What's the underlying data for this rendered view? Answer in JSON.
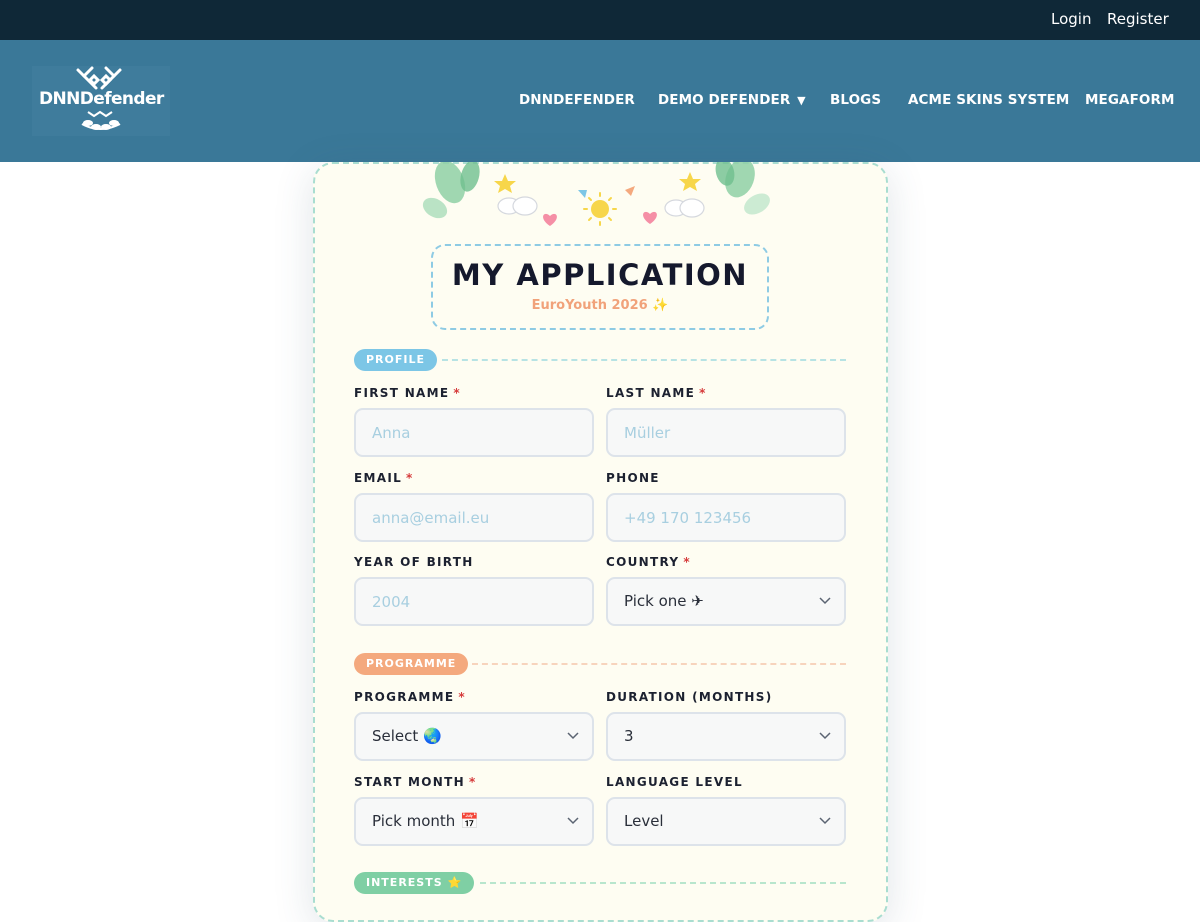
{
  "topbar": {
    "login": "Login",
    "register": "Register"
  },
  "header": {
    "logo_text": "DNNDefender",
    "nav": [
      "DNNDEFENDER",
      "DEMO DEFENDER",
      "BLOGS",
      "ACME SKINS SYSTEM",
      "MEGAFORM"
    ],
    "caret": "▼"
  },
  "form": {
    "title": "MY APPLICATION",
    "subtitle": "EuroYouth 2026 ✨",
    "sections": {
      "profile": "PROFILE",
      "programme": "PROGRAMME",
      "interests": "INTERESTS ⭐"
    },
    "required_mark": "*",
    "first_name": {
      "label": "FIRST NAME",
      "placeholder": "Anna"
    },
    "last_name": {
      "label": "LAST NAME",
      "placeholder": "Müller"
    },
    "email": {
      "label": "EMAIL",
      "placeholder": "anna@email.eu"
    },
    "phone": {
      "label": "PHONE",
      "placeholder": "+49 170 123456"
    },
    "year_of_birth": {
      "label": "YEAR OF BIRTH",
      "placeholder": "2004"
    },
    "country": {
      "label": "COUNTRY",
      "value": "Pick one ✈"
    },
    "programme": {
      "label": "PROGRAMME",
      "value": "Select 🌏"
    },
    "duration": {
      "label": "DURATION (MONTHS)",
      "value": "3"
    },
    "start_month": {
      "label": "START MONTH",
      "value": "Pick month 📅"
    },
    "language_level": {
      "label": "LANGUAGE LEVEL",
      "value": "Level"
    }
  },
  "colors": {
    "topbar": "#0f2837",
    "header": "#3a7898",
    "card": "#fefdf2",
    "profile_pill": "#7cc6e6",
    "programme_pill": "#f4a97e",
    "interests_pill": "#7fcfa4",
    "required": "#d63b3b"
  }
}
